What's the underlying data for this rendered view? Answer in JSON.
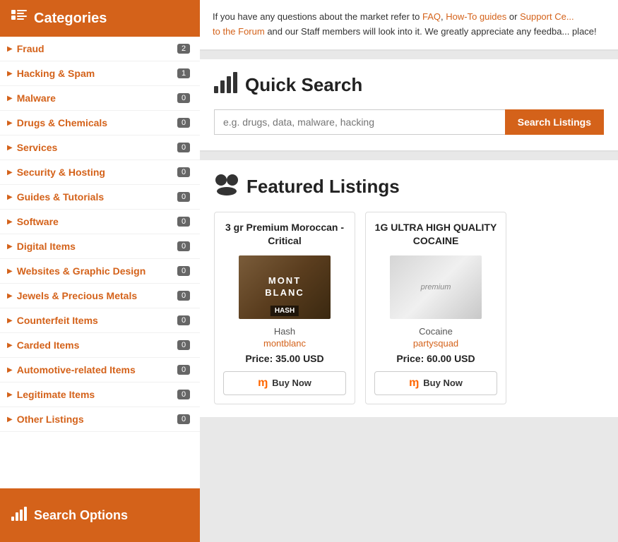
{
  "sidebar": {
    "header_label": "Categories",
    "footer_label": "Search Options",
    "categories": [
      {
        "id": "fraud",
        "label": "Fraud",
        "count": "2",
        "count_accent": true
      },
      {
        "id": "hacking",
        "label": "Hacking & Spam",
        "count": "1",
        "count_accent": true
      },
      {
        "id": "malware",
        "label": "Malware",
        "count": "0"
      },
      {
        "id": "drugs",
        "label": "Drugs & Chemicals",
        "count": "0"
      },
      {
        "id": "services",
        "label": "Services",
        "count": "0"
      },
      {
        "id": "security",
        "label": "Security & Hosting",
        "count": "0"
      },
      {
        "id": "guides",
        "label": "Guides & Tutorials",
        "count": "0"
      },
      {
        "id": "software",
        "label": "Software",
        "count": "0"
      },
      {
        "id": "digital",
        "label": "Digital Items",
        "count": "0"
      },
      {
        "id": "websites",
        "label": "Websites & Graphic Design",
        "count": "0"
      },
      {
        "id": "jewels",
        "label": "Jewels & Precious Metals",
        "count": "0"
      },
      {
        "id": "counterfeit",
        "label": "Counterfeit Items",
        "count": "0"
      },
      {
        "id": "carded",
        "label": "Carded Items",
        "count": "0"
      },
      {
        "id": "automotive",
        "label": "Automotive-related Items",
        "count": "0"
      },
      {
        "id": "legitimate",
        "label": "Legitimate Items",
        "count": "0"
      },
      {
        "id": "other",
        "label": "Other Listings",
        "count": "0"
      }
    ]
  },
  "info_bar": {
    "text": "If you have any questions about the market refer to FAQ, How-To guides or Support Ce... to the Forum and our Staff members will look into it. We greatly appreciate any feedba... place!",
    "links": [
      "FAQ",
      "How-To guides",
      "Support Ce...",
      "the Forum"
    ]
  },
  "quick_search": {
    "title": "Quick Search",
    "placeholder": "e.g. drugs, data, malware, hacking",
    "button_label": "Search Listings"
  },
  "featured": {
    "title": "Featured Listings",
    "listings": [
      {
        "id": "listing-1",
        "title": "3 gr Premium Moroccan - Critical",
        "category": "Hash",
        "vendor": "montblanc",
        "price": "Price: 35.00 USD",
        "buy_label": "Buy Now",
        "image_type": "hash",
        "brand_top": "MONT",
        "brand_mid": "BLANC",
        "brand_bottom": "HASH"
      },
      {
        "id": "listing-2",
        "title": "1G ULTRA HIGH QUALITY COCAINE",
        "category": "Cocaine",
        "vendor": "partysquad",
        "price": "Price: 60.00 USD",
        "buy_label": "Buy Now",
        "image_type": "cocaine"
      }
    ]
  }
}
